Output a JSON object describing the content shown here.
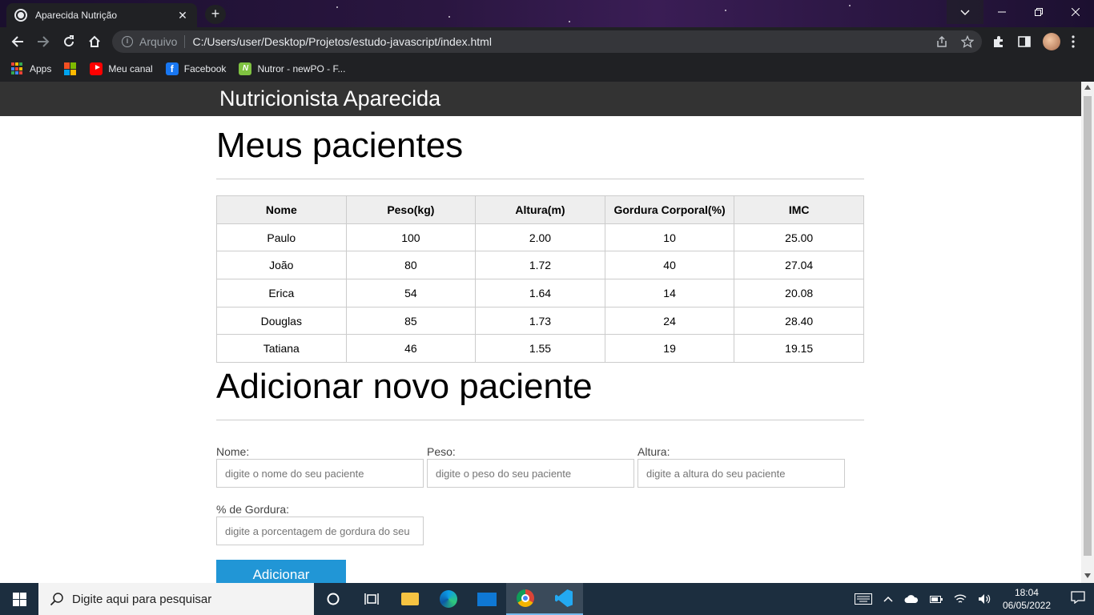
{
  "browser": {
    "tab_title": "Aparecida Nutrição",
    "tab_close": "✕",
    "new_tab": "+",
    "address_protocol": "Arquivo",
    "address_url": "C:/Users/user/Desktop/Projetos/estudo-javascript/index.html",
    "bookmarks": [
      {
        "label": "Apps",
        "icon": "apps-grid-icon"
      },
      {
        "label": "",
        "icon": "microsoft-icon"
      },
      {
        "label": "Meu canal",
        "icon": "youtube-icon"
      },
      {
        "label": "Facebook",
        "icon": "facebook-icon"
      },
      {
        "label": "Nutror - newPO - F...",
        "icon": "nutror-icon"
      }
    ]
  },
  "page": {
    "site_title": "Nutricionista Aparecida",
    "patients_heading": "Meus pacientes",
    "table": {
      "headers": [
        "Nome",
        "Peso(kg)",
        "Altura(m)",
        "Gordura Corporal(%)",
        "IMC"
      ],
      "rows": [
        [
          "Paulo",
          "100",
          "2.00",
          "10",
          "25.00"
        ],
        [
          "João",
          "80",
          "1.72",
          "40",
          "27.04"
        ],
        [
          "Erica",
          "54",
          "1.64",
          "14",
          "20.08"
        ],
        [
          "Douglas",
          "85",
          "1.73",
          "24",
          "28.40"
        ],
        [
          "Tatiana",
          "46",
          "1.55",
          "19",
          "19.15"
        ]
      ]
    },
    "form_heading": "Adicionar novo paciente",
    "form": {
      "nome_label": "Nome:",
      "nome_placeholder": "digite o nome do seu paciente",
      "peso_label": "Peso:",
      "peso_placeholder": "digite o peso do seu paciente",
      "altura_label": "Altura:",
      "altura_placeholder": "digite a altura do seu paciente",
      "gordura_label": "% de Gordura:",
      "gordura_placeholder": "digite a porcentagem de gordura do seu",
      "submit_label": "Adicionar"
    }
  },
  "taskbar": {
    "search_placeholder": "Digite aqui para pesquisar",
    "time": "18:04",
    "date": "06/05/2022"
  },
  "colors": {
    "header_bg": "#333333",
    "button_bg": "#2196d6",
    "table_header_bg": "#eeeeee"
  }
}
